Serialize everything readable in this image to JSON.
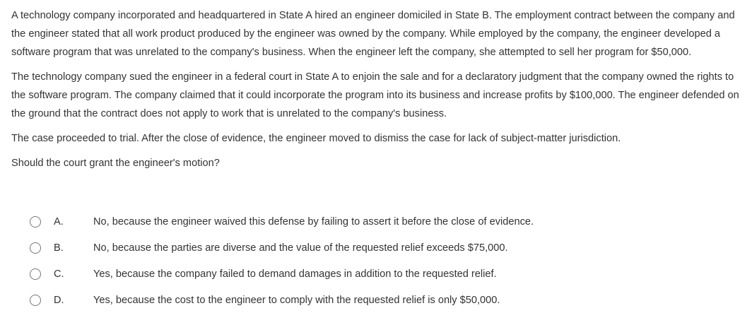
{
  "question": {
    "paragraphs": [
      "A technology company incorporated and headquartered in State A hired an engineer domiciled in State B.  The employment contract between the company and the engineer stated that all work product produced by the engineer was owned by the company.  While employed by the company, the engineer developed a software program that was unrelated to the company's business.  When the engineer left the company, she attempted to sell her program for $50,000.",
      "The technology company sued the engineer in a federal court in State A to enjoin the sale and for a declaratory judgment that the company owned the rights to the software program.  The company claimed that it could incorporate the program into its business and increase profits by $100,000.  The engineer defended on the ground that the contract does not apply to work that is unrelated to the company's business.",
      "The case proceeded to trial.  After the close of evidence, the engineer moved to dismiss the case for lack of subject-matter jurisdiction.",
      "Should the court grant the engineer's motion?"
    ]
  },
  "options": [
    {
      "letter": "A.",
      "text": "No, because the engineer waived this defense by failing to assert it before the close of evidence."
    },
    {
      "letter": "B.",
      "text": "No, because the parties are diverse and the value of the requested relief exceeds $75,000."
    },
    {
      "letter": "C.",
      "text": "Yes, because the company failed to demand damages in addition to the requested relief."
    },
    {
      "letter": "D.",
      "text": "Yes, because the cost to the engineer to comply with the requested relief is only $50,000."
    }
  ],
  "selected_option": null
}
